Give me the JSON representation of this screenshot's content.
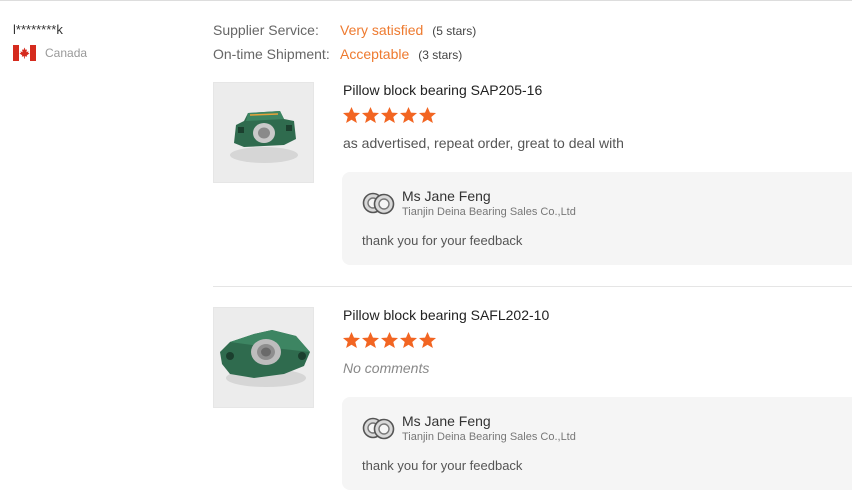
{
  "reviewer": {
    "name": "l********k",
    "country": "Canada",
    "flag_icon": "canada-flag-icon"
  },
  "ratings": [
    {
      "label": "Supplier Service:",
      "value": "Very satisfied",
      "count": "(5 stars)"
    },
    {
      "label": "On-time Shipment:",
      "value": "Acceptable",
      "count": "(3 stars)"
    }
  ],
  "reviews": [
    {
      "product": "Pillow block bearing SAP205-16",
      "stars": 5,
      "comment": "as advertised, repeat order, great to deal with",
      "image_icon": "pillow-block-bearing-image",
      "reply": {
        "name": "Ms Jane Feng",
        "company": "Tianjin Deina Bearing Sales Co.,Ltd",
        "text": "thank you for your feedback"
      }
    },
    {
      "product": "Pillow block bearing SAFL202-10",
      "stars": 5,
      "comment": "No comments",
      "image_icon": "flange-bearing-image",
      "reply": {
        "name": "Ms Jane Feng",
        "company": "Tianjin Deina Bearing Sales Co.,Ltd",
        "text": "thank you for your feedback"
      }
    }
  ],
  "colors": {
    "accent": "#ee7a2f",
    "star": "#f26522",
    "reply_bg": "#f5f5f5"
  }
}
